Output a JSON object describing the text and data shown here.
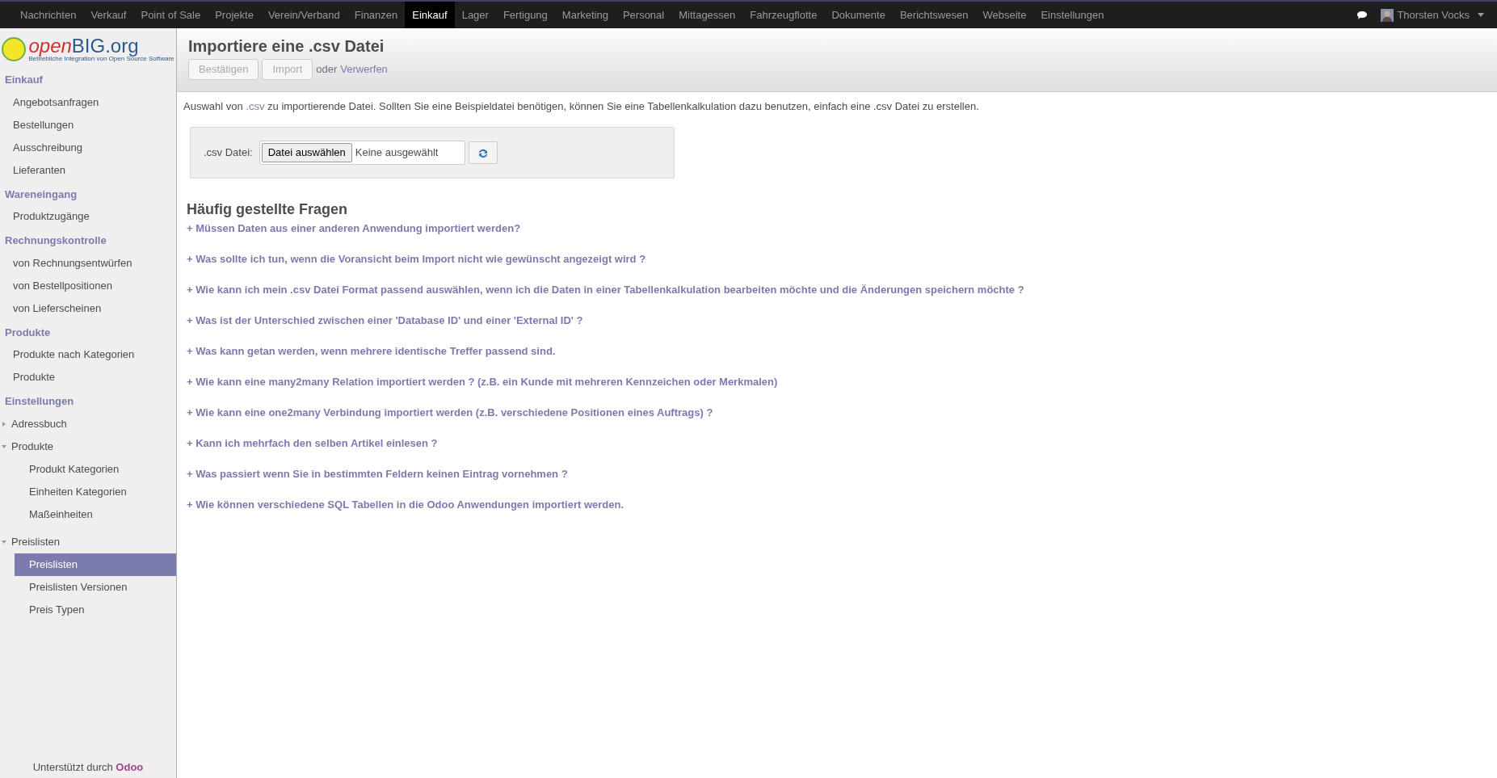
{
  "top_menu": [
    {
      "label": "Nachrichten",
      "selected": false
    },
    {
      "label": "Verkauf",
      "selected": false
    },
    {
      "label": "Point of Sale",
      "selected": false
    },
    {
      "label": "Projekte",
      "selected": false
    },
    {
      "label": "Verein/Verband",
      "selected": false
    },
    {
      "label": "Finanzen",
      "selected": false
    },
    {
      "label": "Einkauf",
      "selected": true
    },
    {
      "label": "Lager",
      "selected": false
    },
    {
      "label": "Fertigung",
      "selected": false
    },
    {
      "label": "Marketing",
      "selected": false
    },
    {
      "label": "Personal",
      "selected": false
    },
    {
      "label": "Mittagessen",
      "selected": false
    },
    {
      "label": "Fahrzeugflotte",
      "selected": false
    },
    {
      "label": "Dokumente",
      "selected": false
    },
    {
      "label": "Berichtswesen",
      "selected": false
    },
    {
      "label": "Webseite",
      "selected": false
    },
    {
      "label": "Einstellungen",
      "selected": false
    }
  ],
  "user": {
    "name": "Thorsten Vocks"
  },
  "logo": {
    "name_a": "open",
    "name_b": "BIG.org",
    "tagline": "Betriebliche Integration von Open Source Software"
  },
  "sidebar": [
    {
      "title": "Einkauf",
      "items": [
        {
          "label": "Angebotsanfragen",
          "selected": false
        },
        {
          "label": "Bestellungen",
          "selected": false
        },
        {
          "label": "Ausschreibung",
          "selected": false
        },
        {
          "label": "Lieferanten",
          "selected": false
        }
      ]
    },
    {
      "title": "Wareneingang",
      "items": [
        {
          "label": "Produktzugänge",
          "selected": false
        }
      ]
    },
    {
      "title": "Rechnungskontrolle",
      "items": [
        {
          "label": "von Rechnungsentwürfen",
          "selected": false
        },
        {
          "label": "von Bestellpositionen",
          "selected": false
        },
        {
          "label": "von Lieferscheinen",
          "selected": false
        }
      ]
    },
    {
      "title": "Produkte",
      "items": [
        {
          "label": "Produkte nach Kategorien",
          "selected": false
        },
        {
          "label": "Produkte",
          "selected": false
        }
      ]
    },
    {
      "title": "Einstellungen",
      "items": [
        {
          "label": "Adressbuch",
          "selected": false,
          "expanded": false
        },
        {
          "label": "Produkte",
          "selected": false,
          "expanded": true,
          "children": [
            {
              "label": "Produkt Kategorien",
              "selected": false
            },
            {
              "label": "Einheiten Kategorien",
              "selected": false
            },
            {
              "label": "Maßeinheiten",
              "selected": false
            }
          ]
        },
        {
          "label": "Preislisten",
          "selected": false,
          "expanded": true,
          "children": [
            {
              "label": "Preislisten",
              "selected": true
            },
            {
              "label": "Preislisten Versionen",
              "selected": false
            },
            {
              "label": "Preis Typen",
              "selected": false
            }
          ]
        }
      ]
    }
  ],
  "footer": {
    "text": "Unterstützt durch",
    "link": "Odoo"
  },
  "header": {
    "title": "Importiere eine .csv Datei",
    "buttons": [
      {
        "label": "Bestätigen",
        "disabled": true
      },
      {
        "label": "Import",
        "disabled": true
      }
    ],
    "or_text": "oder",
    "discard": "Verwerfen"
  },
  "intro": {
    "before": "Auswahl von ",
    "link": ".csv",
    "after": " zu importierende Datei. Sollten Sie eine Beispieldatei benötigen, können Sie eine Tabellenkalkulation dazu benutzen, einfach eine .csv Datei zu erstellen."
  },
  "file_form": {
    "label": ".csv Datei:",
    "choose_button": "Datei auswählen",
    "value": "Keine ausgewählt"
  },
  "faq": {
    "title": "Häufig gestellte Fragen",
    "questions": [
      "+ Müssen Daten aus einer anderen Anwendung importiert werden?",
      "+ Was sollte ich tun, wenn die Voransicht beim Import nicht wie gewünscht angezeigt wird ?",
      "+ Wie kann ich mein .csv Datei Format passend auswählen, wenn ich die Daten in einer Tabellenkalkulation bearbeiten möchte und die Änderungen speichern möchte ?",
      "+ Was ist der Unterschied zwischen einer 'Database ID' und einer 'External ID' ?",
      "+ Was kann getan werden, wenn mehrere identische Treffer passend sind.",
      "+ Wie kann eine many2many Relation importiert werden ? (z.B. ein Kunde mit mehreren Kennzeichen oder Merkmalen)",
      "+ Wie kann eine one2many Verbindung importiert werden (z.B. verschiedene Positionen eines Auftrags) ?",
      "+ Kann ich mehrfach den selben Artikel einlesen ?",
      "+ Was passiert wenn Sie in bestimmten Feldern keinen Eintrag vornehmen ?",
      "+ Wie können verschiedene SQL Tabellen in die Odoo Anwendungen importiert werden."
    ]
  }
}
